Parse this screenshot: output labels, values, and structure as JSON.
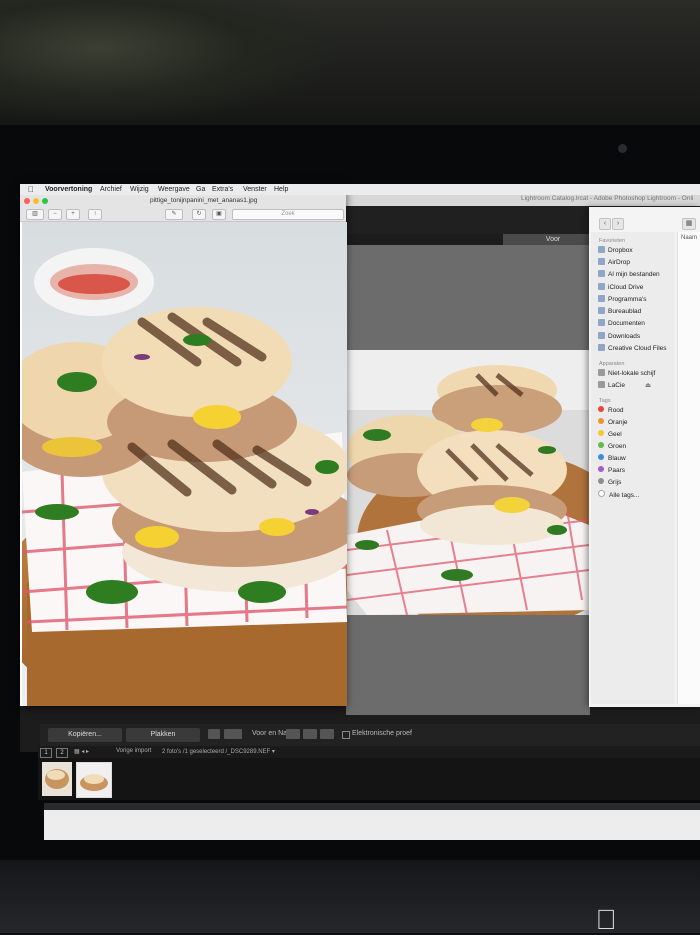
{
  "preview": {
    "menu": [
      "Voorvertoning",
      "Archief",
      "Wijzig",
      "Weergave",
      "Ga",
      "Extra's",
      "Venster",
      "Help"
    ],
    "filename": "pittige_tonijnpanini_met_ananas1.jpg",
    "search_placeholder": "Zoek"
  },
  "lightroom": {
    "title": "Lightroom Catalog.lrcat - Adobe Photoshop Lightroom - Onli",
    "view_label": "Voor",
    "copy_button": "Kopiëren...",
    "paste_button": "Plakken",
    "compare_label": "Voor en Na:",
    "softproof_label": "Elektronische proef",
    "filmstrip": {
      "page1": "1",
      "page2": "2",
      "prev_import": "Vorige import",
      "info": "2 foto's /1 geselecteerd /_DSC9289.NEF ▾"
    }
  },
  "finder": {
    "favorites_header": "Favorieten",
    "favorites": [
      "Dropbox",
      "AirDrop",
      "Al mijn bestanden",
      "iCloud Drive",
      "Programma's",
      "Bureaublad",
      "Documenten",
      "Downloads",
      "Creative Cloud Files"
    ],
    "devices_header": "Apparaten",
    "devices": [
      "Niet-lokale schijf",
      "LaCie"
    ],
    "tags_header": "Tags",
    "tags": [
      {
        "name": "Rood",
        "color": "#e5473b"
      },
      {
        "name": "Oranje",
        "color": "#f2922a"
      },
      {
        "name": "Geel",
        "color": "#f1cb2d"
      },
      {
        "name": "Groen",
        "color": "#5cbd4a"
      },
      {
        "name": "Blauw",
        "color": "#3d8be0"
      },
      {
        "name": "Paars",
        "color": "#a45bc8"
      },
      {
        "name": "Grijs",
        "color": "#8e8e8e"
      }
    ],
    "all_tags": "Alle tags...",
    "column_header": "Naam"
  },
  "colors": {
    "traffic_close": "#fc5f57",
    "traffic_min": "#fdbc2e",
    "traffic_max": "#28c840"
  }
}
